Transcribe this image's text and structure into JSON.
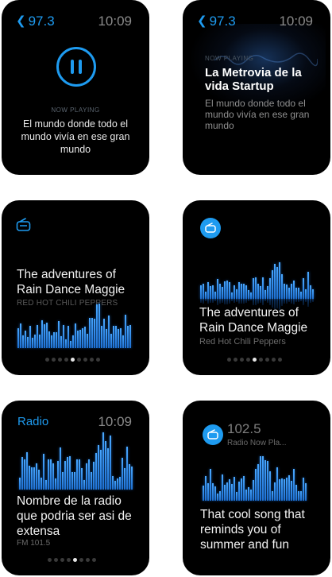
{
  "screens": {
    "s1": {
      "back_label": "97.3",
      "time": "10:09",
      "now_playing": "NOW PLAYING",
      "song": "El mundo donde todo el mundo vivía en ese gran mundo"
    },
    "s2": {
      "back_label": "97.3",
      "time": "10:09",
      "now_playing": "NOW PLAYING",
      "title": "La Metrovia de la vida Startup",
      "song": "El mundo donde todo el mundo vivía en ese gran mundo"
    },
    "s3": {
      "title": "The adventures of Rain Dance Maggie",
      "artist": "RED HOT CHILI PEPPERS",
      "page": 5,
      "page_count": 9
    },
    "s4": {
      "title": "The adventures of Rain Dance Maggie",
      "artist": "Red Hot Chili Peppers",
      "page": 5,
      "page_count": 9
    },
    "s5": {
      "label": "Radio",
      "time": "10:09",
      "title": "Nombre de la radio que podria ser asi de extensa",
      "frequency": "FM 101.5",
      "page": 5,
      "page_count": 8
    },
    "s6": {
      "frequency": "102.5",
      "subtitle": "Radio Now Pla...",
      "title": "That cool song that reminds you of summer and fun"
    }
  },
  "colors": {
    "accent": "#1e9bf0",
    "background": "#000000",
    "muted": "#8b8b8b"
  },
  "icons": {
    "back": "chevron-left-icon",
    "pause": "pause-icon",
    "radio": "radio-icon"
  }
}
